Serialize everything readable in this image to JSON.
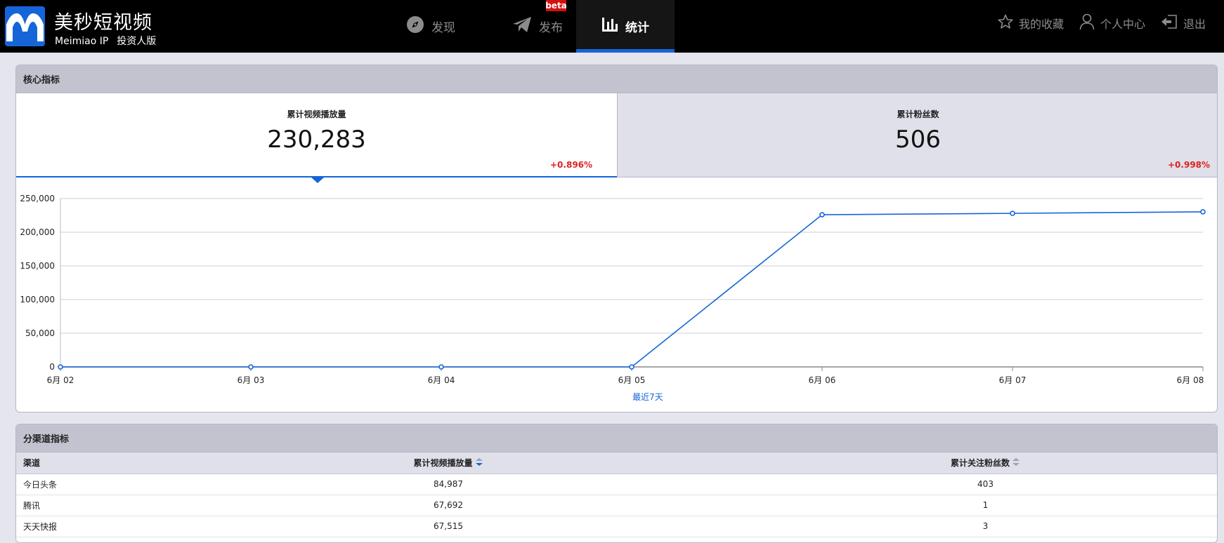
{
  "colors": {
    "accent": "#1565d8",
    "topbar_bg": "#000000",
    "active_tab_bg": "#151515",
    "badge_red": "#d41010",
    "positive_change": "#e02020",
    "panel_header_bg": "#c2c3cf",
    "page_bg": "#e5e5ee"
  },
  "brand": {
    "title": "美秒短视频",
    "sub_name": "Meimiao IP",
    "edition": "投资人版"
  },
  "nav": {
    "items": [
      {
        "label": "发现",
        "icon": "compass-icon",
        "active": false
      },
      {
        "label": "发布",
        "icon": "paper-plane-icon",
        "active": false,
        "badge": "beta"
      },
      {
        "label": "统计",
        "icon": "bar-chart-icon",
        "active": true
      }
    ]
  },
  "user_menu": {
    "favorites": {
      "label": "我的收藏",
      "icon": "star-icon"
    },
    "profile": {
      "label": "个人中心",
      "icon": "user-icon"
    },
    "logout": {
      "label": "退出",
      "icon": "logout-icon"
    }
  },
  "core_metrics": {
    "title": "核心指标",
    "kpis": [
      {
        "label": "累计视频播放量",
        "value": "230,283",
        "change": "+0.896%",
        "selected": true
      },
      {
        "label": "累计粉丝数",
        "value": "506",
        "change": "+0.998%",
        "selected": false
      }
    ]
  },
  "chart_data": {
    "type": "line",
    "title": "",
    "xlabel": "最近7天",
    "ylabel": "",
    "categories": [
      "6月 02",
      "6月 03",
      "6月 04",
      "6月 05",
      "6月 06",
      "6月 07",
      "6月 08"
    ],
    "series": [
      {
        "values": [
          0,
          0,
          0,
          0,
          226000,
          228000,
          230283
        ]
      }
    ],
    "ylim": [
      0,
      250000
    ],
    "yticks": [
      "0",
      "50,000",
      "100,000",
      "150,000",
      "200,000",
      "250,000"
    ],
    "ytick_values": [
      0,
      50000,
      100000,
      150000,
      200000,
      250000
    ],
    "grid": true,
    "legend": "none",
    "line_color": "#1565d8"
  },
  "channel_metrics": {
    "title": "分渠道指标",
    "columns": [
      "渠道",
      "累计视频播放量",
      "累计关注粉丝数"
    ],
    "rows": [
      {
        "channel": "今日头条",
        "views": "84,987",
        "fans": "403"
      },
      {
        "channel": "腾讯",
        "views": "67,692",
        "fans": "1"
      },
      {
        "channel": "天天快报",
        "views": "67,515",
        "fans": "3"
      }
    ]
  }
}
